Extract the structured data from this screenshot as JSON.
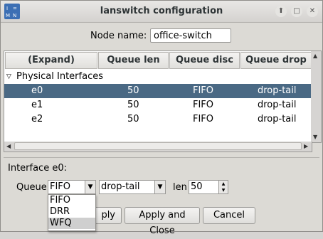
{
  "window": {
    "title": "lanswitch configuration",
    "controls": [
      "up-arrow-icon",
      "maximize-icon",
      "close-icon"
    ]
  },
  "node": {
    "label": "Node name:",
    "value": "office-switch"
  },
  "table": {
    "columns": [
      "(Expand)",
      "Queue len",
      "Queue disc",
      "Queue drop"
    ],
    "group": "Physical Interfaces",
    "rows": [
      {
        "name": "e0",
        "len": "50",
        "disc": "FIFO",
        "drop": "drop-tail",
        "selected": true
      },
      {
        "name": "e1",
        "len": "50",
        "disc": "FIFO",
        "drop": "drop-tail",
        "selected": false
      },
      {
        "name": "e2",
        "len": "50",
        "disc": "FIFO",
        "drop": "drop-tail",
        "selected": false
      }
    ]
  },
  "interface": {
    "label": "Interface e0:",
    "queue_label": "Queue",
    "queue_value": "FIFO",
    "drop_value": "drop-tail",
    "len_label": "len",
    "len_value": "50"
  },
  "dropdown": {
    "options": [
      "FIFO",
      "DRR",
      "WFQ"
    ],
    "hovered": "WFQ"
  },
  "buttons": {
    "apply": "Apply",
    "apply_visible": "ply",
    "apply_close": "Apply and Close",
    "cancel": "Cancel"
  },
  "colors": {
    "selection": "#4a6984",
    "window_bg": "#dcdad5"
  }
}
